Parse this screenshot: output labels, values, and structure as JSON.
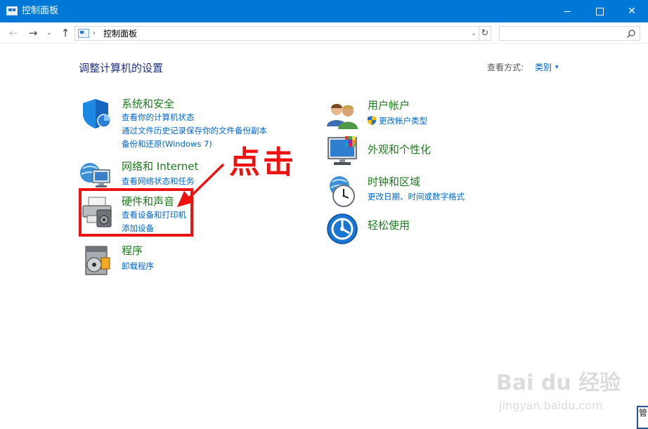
{
  "window": {
    "title": "控制面板"
  },
  "nav": {
    "back_glyph": "←",
    "forward_glyph": "→",
    "recent_glyph": "⌄",
    "up_glyph": "↑",
    "address_separator": "›",
    "address_path": "控制面板",
    "dropdown_glyph": "⌄",
    "refresh_glyph": "↻",
    "search_placeholder": ""
  },
  "window_controls": {
    "close_glyph": "✕"
  },
  "header": {
    "page_title": "调整计算机的设置",
    "view_by_label": "查看方式:",
    "view_by_value": "类别",
    "view_by_caret": "▾"
  },
  "categories_left": [
    {
      "title": "系统和安全",
      "icon": "shield-icon",
      "links": [
        "查看你的计算机状态",
        "通过文件历史记录保存你的文件备份副本",
        "备份和还原(Windows 7)"
      ]
    },
    {
      "title": "网络和 Internet",
      "icon": "network-icon",
      "links": [
        "查看网络状态和任务"
      ]
    },
    {
      "title": "硬件和声音",
      "icon": "printer-icon",
      "links": [
        "查看设备和打印机",
        "添加设备"
      ]
    },
    {
      "title": "程序",
      "icon": "programs-icon",
      "links": [
        "卸载程序"
      ]
    }
  ],
  "categories_right": [
    {
      "title": "用户帐户",
      "icon": "users-icon",
      "links": [
        "更改帐户类型"
      ]
    },
    {
      "title": "外观和个性化",
      "icon": "monitor-icon",
      "links": []
    },
    {
      "title": "时钟和区域",
      "icon": "clock-globe-icon",
      "links": [
        "更改日期、时间或数字格式"
      ]
    },
    {
      "title": "轻松使用",
      "icon": "ease-of-access-icon",
      "links": []
    }
  ],
  "annotation": {
    "text": "点击",
    "color": "#ee1111"
  },
  "watermark": {
    "brand": "Bai du 经验",
    "url": "jingyan.baidu.com"
  },
  "corner_tab": {
    "text": "管"
  },
  "colors": {
    "titlebar": "#0078d7",
    "category_title": "#1e7a1e",
    "link": "#0066cc",
    "page_title": "#1e3287"
  }
}
